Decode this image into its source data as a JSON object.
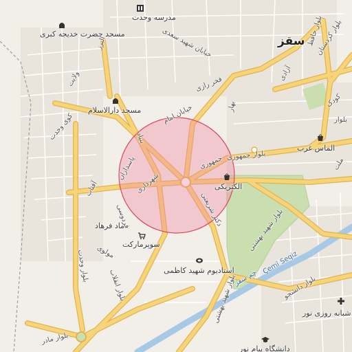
{
  "city": "سقز",
  "pois": {
    "school_wahdat": "مدرسه وحدت",
    "mosque_khadijeh": "مسجد حضرت خدیجه کبری",
    "mosque_daralislam": "مسجد دارالاسلام",
    "almas_gharb": "الماس غرب",
    "electrici": "الکتریکی",
    "mad_farhad": "ماد فرهاد",
    "supermarket": "سوپرمارکت",
    "stadium": "استادیوم شهید کاظمی",
    "pharmacy": "شبانه روزی نور",
    "university": "دانشگاه پیام نور"
  },
  "streets": {
    "khayyam_shahid_saeidi": "خیابان شهید سعدی",
    "fakhr_razi": "فخر رازی",
    "khayaban_imam": "خیابان امام",
    "bahar": "بهار",
    "valiasr": "بلوار ولیعصر",
    "boulevard_jomhouri": "بلوار جمهوری",
    "jomhouri": "جمهوری",
    "pasdaran": "پاسداران",
    "shahrdari": "شهرداری",
    "shahid_beheshti": "بلوار شهید بهشتی",
    "dr_shariati": "دکتر شریعتی",
    "ferdowsi": "فردوسی",
    "mowlavi": "مولوی",
    "boulevard_enghelab": "بلوار انقلاب",
    "boulevard_vahdat": "بلوار وحدت",
    "kordestan": "بلوار کردستان",
    "hafez": "بلوار حافظ",
    "azadi": "آزادی",
    "koudak": "کودک",
    "daneshjoo": "بلوار دانشجو",
    "boulevard_mader": "بلوار مادر",
    "omid": "امید",
    "bolvar": "بلوار",
    "mellat": "ملت",
    "river": "چم سقز",
    "river_latin": "Çemî Seqiz",
    "alborz": "البرز",
    "velayat": "ولایت",
    "kuye_vahdat": "کوی وحدت",
    "aftab": "آفتاب",
    "bonyad": "بنیاد",
    "bagher": "باقر"
  },
  "colors": {
    "background": "#f2efe9",
    "road_major": "#f6d47a",
    "road_major_casing": "#e3b34e",
    "road_minor": "#ffffff",
    "park": "#c9dfb0",
    "river": "#a8c9e6",
    "highlight_fill": "#f08aa0",
    "highlight_stroke": "#d9485f"
  },
  "highlight": {
    "shape": "circle"
  }
}
